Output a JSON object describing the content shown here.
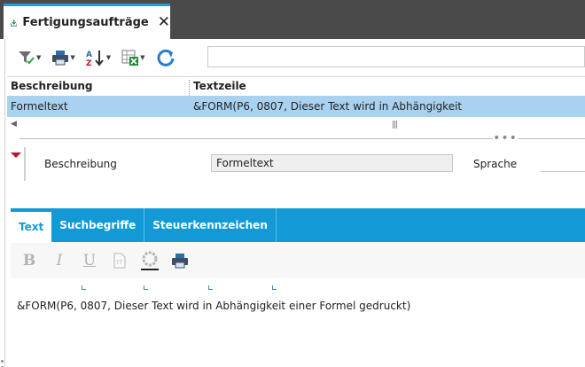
{
  "window": {
    "tab_title": "Fertigungsaufträge",
    "tab_icon": "download-icon",
    "close_icon": "close-icon",
    "accent": "#2b9bd6"
  },
  "toolbar": {
    "buttons": [
      "filter-icon",
      "print-icon",
      "sort-az-icon",
      "export-excel-icon",
      "refresh-icon"
    ],
    "search_value": ""
  },
  "table": {
    "columns": [
      "Beschreibung",
      "Textzeile"
    ],
    "rows": [
      [
        "Formeltext",
        "&FORM(P6, 0807, Dieser Text wird in Abhängigkeit"
      ]
    ],
    "selected_row_color": "#a9d2f0"
  },
  "detail": {
    "beschreibung_label": "Beschreibung",
    "beschreibung_value": "Formeltext",
    "sprache_label": "Sprache",
    "sprache_value": ""
  },
  "tabs": {
    "items": [
      "Text",
      "Suchbegriffe",
      "Steuerkennzeichen"
    ],
    "active": "Text",
    "bar_color": "#139ad6"
  },
  "editor": {
    "toolbar_icons": [
      "bold-icon",
      "italic-icon",
      "underline-icon",
      "text-format-icon",
      "color-wheel-icon",
      "print-icon"
    ],
    "bold_glyph": "B",
    "italic_glyph": "I",
    "underline_glyph": "U",
    "content": "&FORM(P6, 0807, Dieser Text wird in Abhängigkeit einer Formel gedruckt)"
  }
}
